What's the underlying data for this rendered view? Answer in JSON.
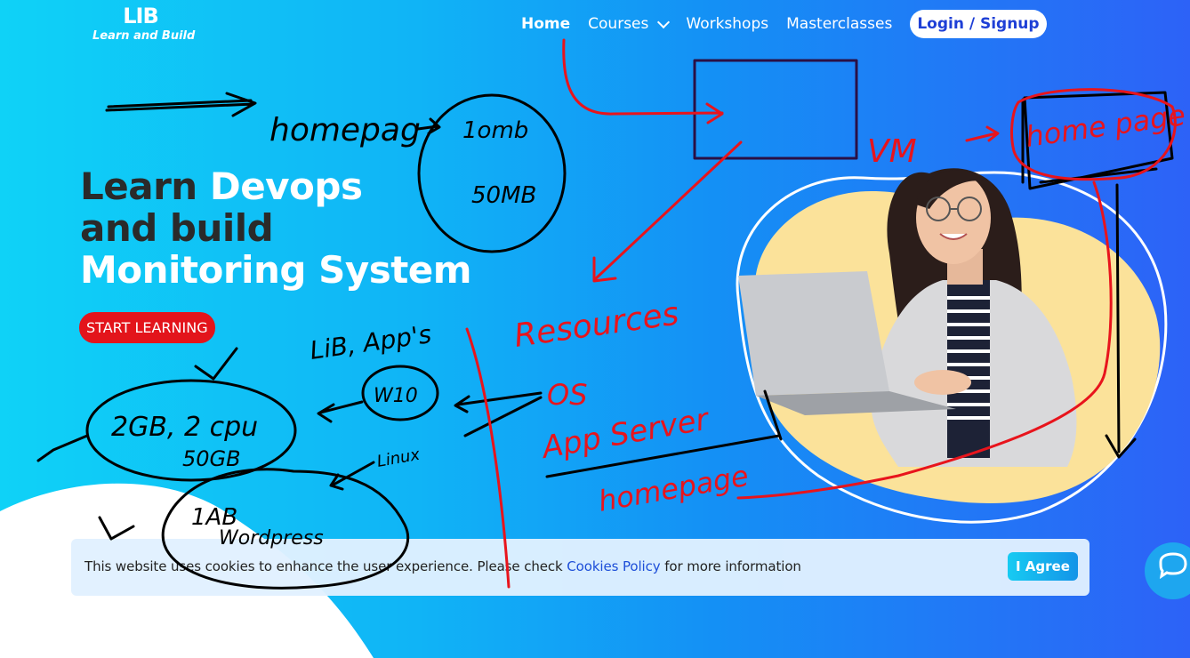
{
  "brand": {
    "mark": "LIB",
    "name": "Learn and Build"
  },
  "nav": {
    "items": [
      "Home",
      "Courses",
      "Workshops",
      "Masterclasses"
    ],
    "login": "Login / Signup"
  },
  "hero": {
    "line1_dark": "Learn ",
    "line1_light": "Devops",
    "line2": "and build",
    "line3": "Monitoring System",
    "cta": "START LEARNING"
  },
  "cookie": {
    "text_before": "This website uses cookies to enhance the user experience. Please check ",
    "link": "Cookies Policy",
    "text_after": " for more information",
    "agree": "I Agree"
  },
  "handwriting": {
    "homepage_left": "homepag",
    "circle_top": "1omb",
    "circle_bottom": "50MB",
    "lib_apps": "LiB, App's",
    "ram_cpu": "2GB, 2 cpu",
    "sdk": "50GB",
    "w10": "W10",
    "linux": "Linux",
    "iab": "1AB",
    "wordpress": "Wordpress",
    "vm": "VM",
    "homepage_right": "home page",
    "resources": "Resources",
    "os": "OS",
    "app_server": "App Server",
    "homepage_bottom": "homepage"
  },
  "colors": {
    "ink_black": "#000000",
    "ink_red": "#e8141c",
    "blob_yellow": "#fbe29a"
  }
}
